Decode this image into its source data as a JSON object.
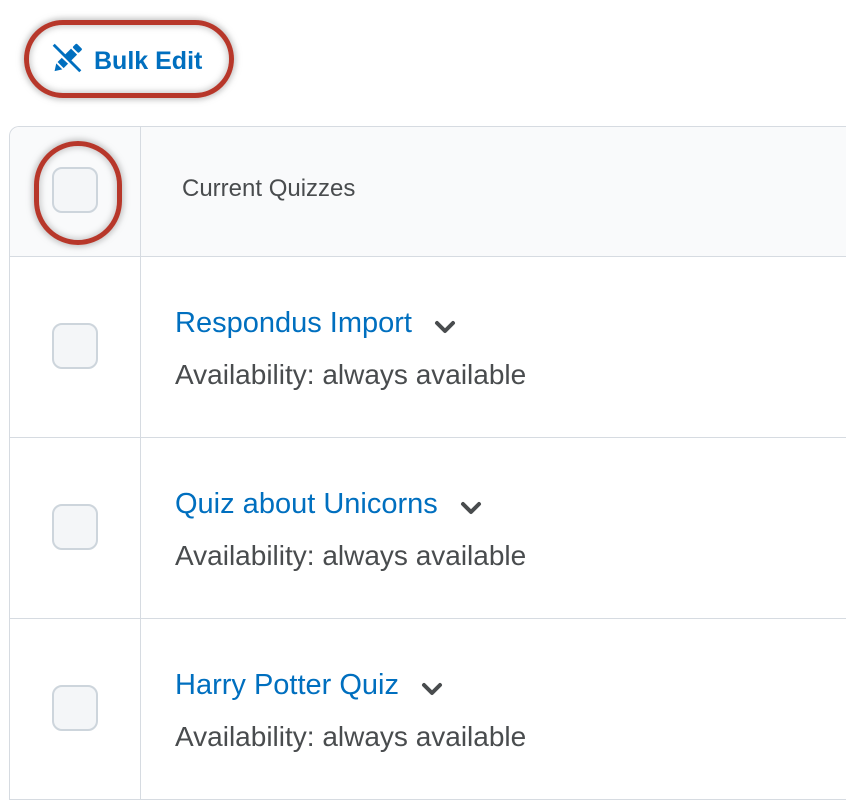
{
  "toolbar": {
    "bulk_edit_label": "Bulk Edit",
    "bulk_edit_icon": "pencil-icon"
  },
  "table": {
    "header": {
      "column_title": "Current Quizzes",
      "select_all_checked": false
    },
    "rows": [
      {
        "title": "Respondus Import",
        "availability": "Availability: always available",
        "checked": false
      },
      {
        "title": "Quiz about Unicorns",
        "availability": "Availability: always available",
        "checked": false
      },
      {
        "title": "Harry Potter Quiz",
        "availability": "Availability: always available",
        "checked": false
      }
    ]
  },
  "colors": {
    "link": "#006fbf",
    "highlight": "#b7372a",
    "border": "#d6dbe1",
    "text": "#494c4e"
  }
}
